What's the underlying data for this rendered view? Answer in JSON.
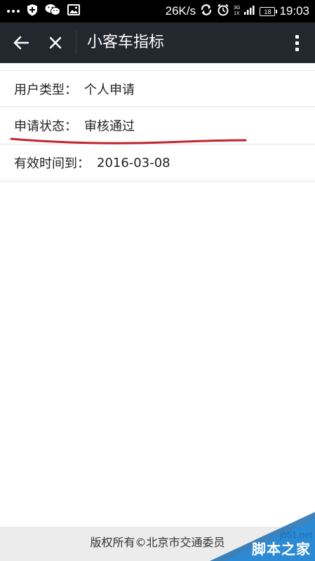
{
  "status_bar": {
    "net_speed": "26K/s",
    "network": "3G",
    "network_sub": "1X",
    "battery": "18",
    "time": "19:03",
    "icons": [
      "more-dots-icon",
      "shield-plus-icon",
      "wechat-icon",
      "image-icon",
      "sync-icon",
      "alarm-icon",
      "signal-icon",
      "battery-icon"
    ]
  },
  "app_bar": {
    "title": "小客车指标",
    "icons": [
      "back-arrow-icon",
      "close-icon",
      "more-vertical-icon"
    ]
  },
  "info": {
    "rows": [
      {
        "label": "用户类型：",
        "value": "个人申请"
      },
      {
        "label": "申请状态：",
        "value": "审核通过"
      },
      {
        "label": "有效时间到：",
        "value": "2016-03-08"
      }
    ]
  },
  "annotation": {
    "color": "#c0262d"
  },
  "footer": {
    "text": "版权所有©北京市交通委员"
  },
  "watermark": {
    "site": "jb51.net",
    "name": "脚本之家"
  },
  "colors": {
    "status_bar": "#000000",
    "app_bar": "#23272e",
    "footer_bg": "#ececec",
    "watermark_blue": "#1e6fb3"
  }
}
